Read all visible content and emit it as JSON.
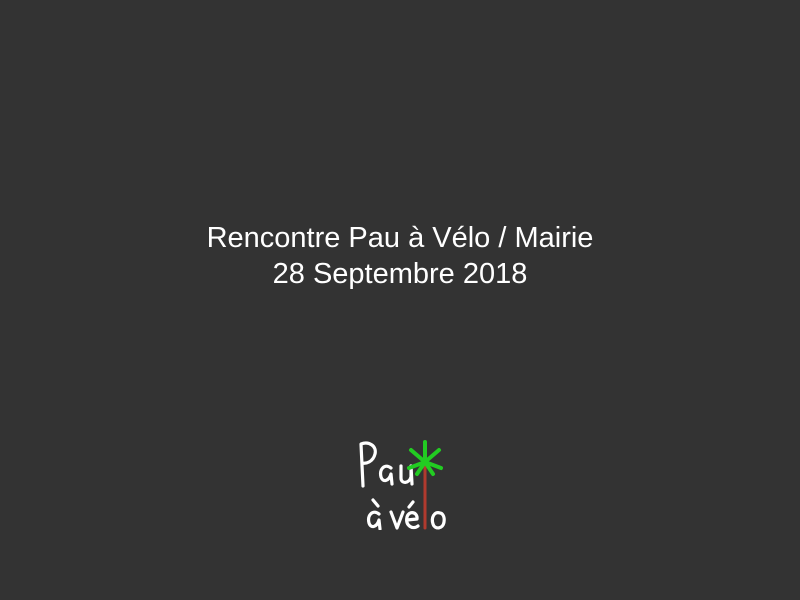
{
  "slide": {
    "title_line1": "Rencontre Pau à Vélo / Mairie",
    "title_line2": "28 Septembre 2018"
  },
  "logo": {
    "text_line1": "Pau",
    "text_line2": "à vélo",
    "icon": "palm-tree-icon",
    "leaf_color": "#22cc22",
    "trunk_color": "#b03a2e",
    "text_color": "#ffffff"
  },
  "colors": {
    "background": "#333333",
    "text": "#ffffff"
  }
}
